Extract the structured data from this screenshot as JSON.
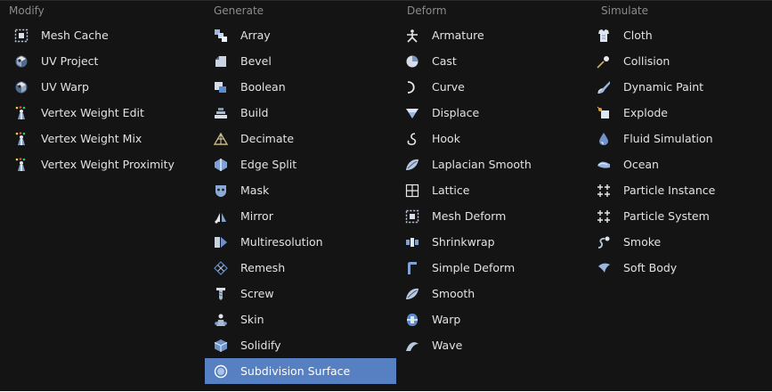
{
  "columns": [
    {
      "header": "Modify",
      "items": [
        {
          "label": "Mesh Cache",
          "icon": "mesh-cache-icon"
        },
        {
          "label": "UV Project",
          "icon": "uv-project-icon"
        },
        {
          "label": "UV Warp",
          "icon": "uv-warp-icon"
        },
        {
          "label": "Vertex Weight Edit",
          "icon": "vertex-weight-icon"
        },
        {
          "label": "Vertex Weight Mix",
          "icon": "vertex-weight-icon"
        },
        {
          "label": "Vertex Weight Proximity",
          "icon": "vertex-weight-icon"
        }
      ]
    },
    {
      "header": "Generate",
      "items": [
        {
          "label": "Array",
          "icon": "array-icon"
        },
        {
          "label": "Bevel",
          "icon": "bevel-icon"
        },
        {
          "label": "Boolean",
          "icon": "boolean-icon"
        },
        {
          "label": "Build",
          "icon": "build-icon"
        },
        {
          "label": "Decimate",
          "icon": "decimate-icon"
        },
        {
          "label": "Edge Split",
          "icon": "edge-split-icon"
        },
        {
          "label": "Mask",
          "icon": "mask-icon"
        },
        {
          "label": "Mirror",
          "icon": "mirror-icon"
        },
        {
          "label": "Multiresolution",
          "icon": "multiresolution-icon"
        },
        {
          "label": "Remesh",
          "icon": "remesh-icon"
        },
        {
          "label": "Screw",
          "icon": "screw-icon"
        },
        {
          "label": "Skin",
          "icon": "skin-icon"
        },
        {
          "label": "Solidify",
          "icon": "solidify-icon"
        },
        {
          "label": "Subdivision Surface",
          "icon": "subdivision-surface-icon",
          "active": true
        }
      ]
    },
    {
      "header": "Deform",
      "items": [
        {
          "label": "Armature",
          "icon": "armature-icon"
        },
        {
          "label": "Cast",
          "icon": "cast-icon"
        },
        {
          "label": "Curve",
          "icon": "curve-icon"
        },
        {
          "label": "Displace",
          "icon": "displace-icon"
        },
        {
          "label": "Hook",
          "icon": "hook-icon"
        },
        {
          "label": "Laplacian Smooth",
          "icon": "smooth-icon"
        },
        {
          "label": "Lattice",
          "icon": "lattice-icon"
        },
        {
          "label": "Mesh Deform",
          "icon": "mesh-cache-icon"
        },
        {
          "label": "Shrinkwrap",
          "icon": "shrinkwrap-icon"
        },
        {
          "label": "Simple Deform",
          "icon": "simple-deform-icon"
        },
        {
          "label": "Smooth",
          "icon": "smooth-icon"
        },
        {
          "label": "Warp",
          "icon": "warp-icon"
        },
        {
          "label": "Wave",
          "icon": "wave-icon"
        }
      ]
    },
    {
      "header": "Simulate",
      "items": [
        {
          "label": "Cloth",
          "icon": "cloth-icon"
        },
        {
          "label": "Collision",
          "icon": "collision-icon"
        },
        {
          "label": "Dynamic Paint",
          "icon": "dynamic-paint-icon"
        },
        {
          "label": "Explode",
          "icon": "explode-icon"
        },
        {
          "label": "Fluid Simulation",
          "icon": "fluid-simulation-icon"
        },
        {
          "label": "Ocean",
          "icon": "ocean-icon"
        },
        {
          "label": "Particle Instance",
          "icon": "particles-icon"
        },
        {
          "label": "Particle System",
          "icon": "particles-icon"
        },
        {
          "label": "Smoke",
          "icon": "smoke-icon"
        },
        {
          "label": "Soft Body",
          "icon": "soft-body-icon"
        }
      ]
    }
  ],
  "colors": {
    "background": "#141414",
    "header_text": "#8b8b8b",
    "item_text": "#e2e2e2",
    "active_background": "#5680c2"
  }
}
